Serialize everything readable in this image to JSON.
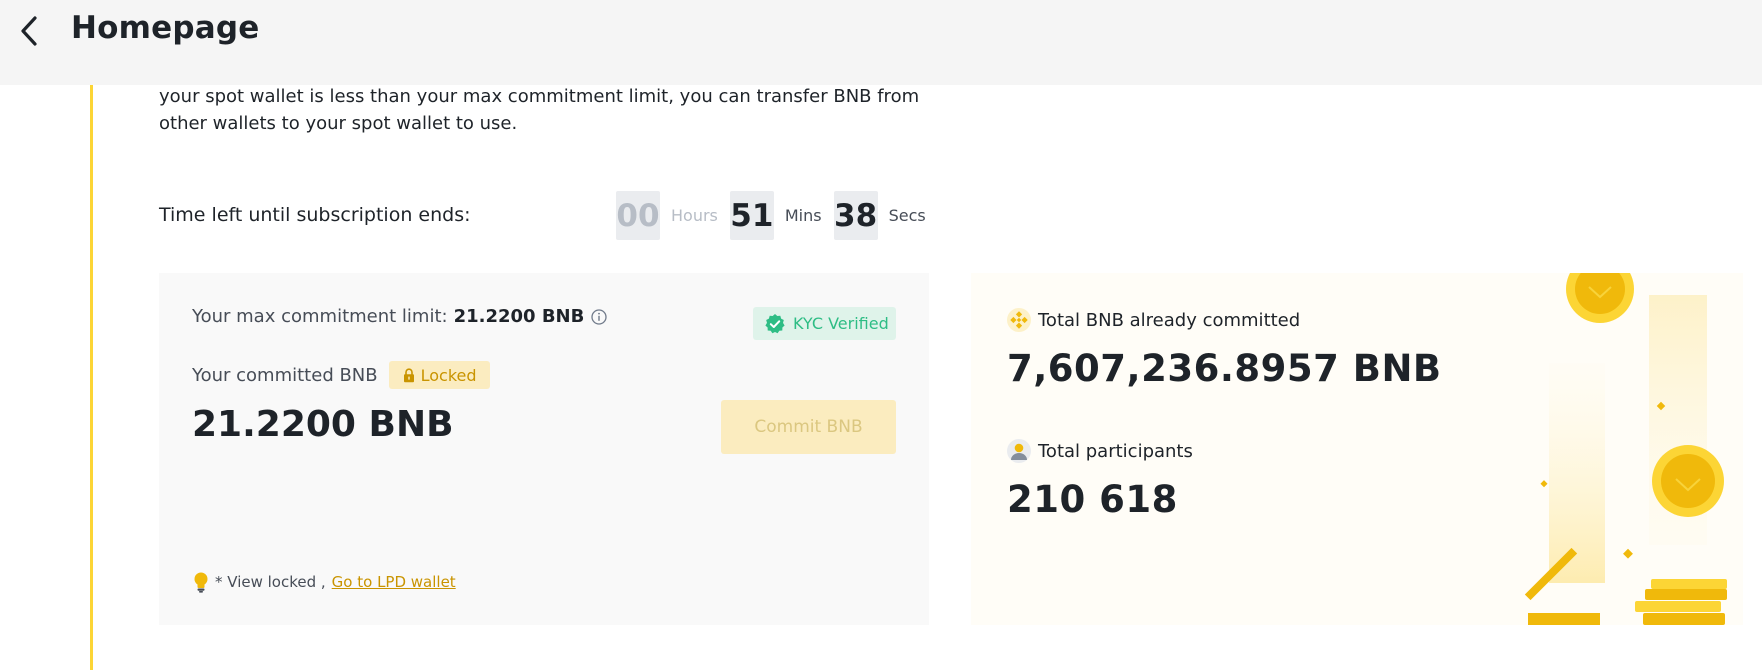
{
  "header": {
    "title": "Homepage"
  },
  "intro": {
    "text": "your spot wallet is less than your max commitment limit, you can transfer BNB from other wallets to your spot wallet to use."
  },
  "countdown": {
    "label": "Time left until subscription ends:",
    "hours": "00",
    "hours_unit": "Hours",
    "mins": "51",
    "mins_unit": "Mins",
    "secs": "38",
    "secs_unit": "Secs"
  },
  "commit_card": {
    "limit_label": "Your max commitment limit:",
    "limit_value": "21.2200 BNB",
    "kyc_label": "KYC Verified",
    "committed_label": "Your committed BNB",
    "locked_label": "Locked",
    "committed_value": "21.2200 BNB",
    "commit_button": "Commit BNB",
    "view_locked_text": "* View locked ,",
    "lpd_link": "Go to LPD wallet"
  },
  "stats_card": {
    "total_committed_label": "Total BNB already committed",
    "total_committed_value": "7,607,236.8957 BNB",
    "participants_label": "Total participants",
    "participants_value": "210 618"
  },
  "colors": {
    "brand_yellow": "#fcd535",
    "gold_text": "#c99400",
    "kyc_green": "#2ebd85",
    "text_primary": "#1e2329",
    "text_secondary": "#474d57"
  },
  "icons": {
    "back": "chevron-left-icon",
    "info": "info-circle-icon",
    "kyc": "check-circle-icon",
    "lock": "lock-icon",
    "bulb": "lightbulb-icon",
    "bnb": "bnb-logo-icon",
    "user": "user-icon"
  }
}
